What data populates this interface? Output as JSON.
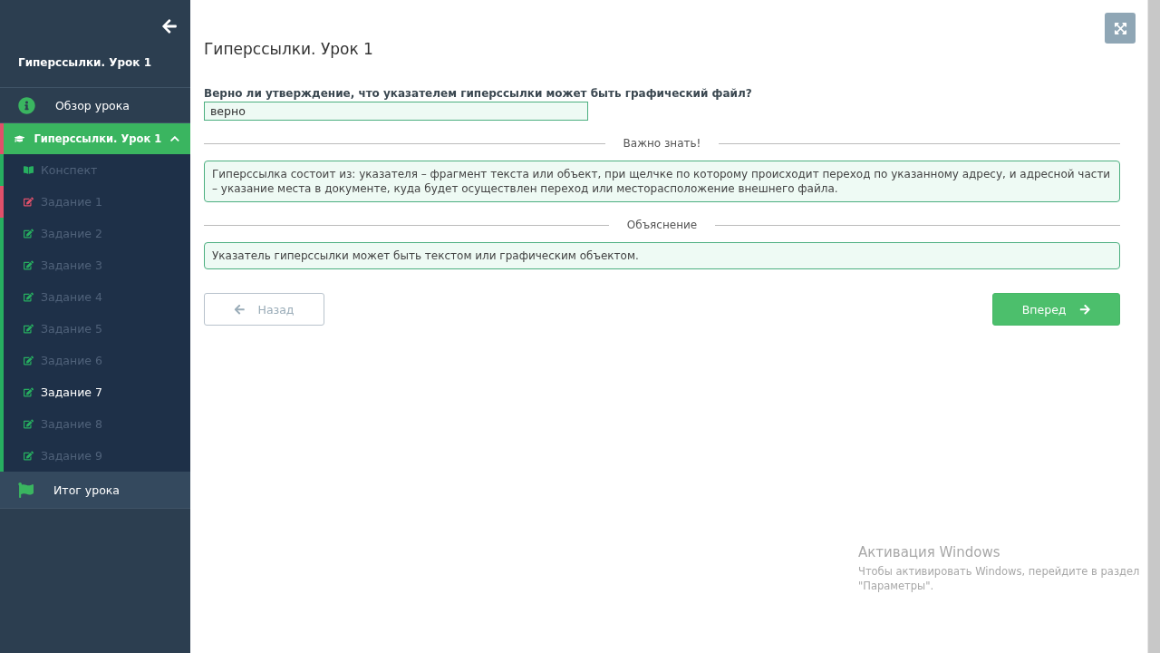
{
  "sidebar": {
    "title": "Гиперссылки. Урок 1",
    "overview": {
      "label": "Обзор урока"
    },
    "lesson": {
      "label": "Гиперссылки. Урок 1",
      "expanded": true,
      "children": [
        {
          "label": "Конспект",
          "kind": "notes",
          "color": "#27ae60",
          "selected": false
        },
        {
          "label": "Задание 1",
          "kind": "task",
          "color": "#e0506a",
          "selected": false
        },
        {
          "label": "Задание 2",
          "kind": "task",
          "color": "#27ae60",
          "selected": false
        },
        {
          "label": "Задание 3",
          "kind": "task",
          "color": "#27ae60",
          "selected": false
        },
        {
          "label": "Задание 4",
          "kind": "task",
          "color": "#27ae60",
          "selected": false
        },
        {
          "label": "Задание 5",
          "kind": "task",
          "color": "#27ae60",
          "selected": false
        },
        {
          "label": "Задание 6",
          "kind": "task",
          "color": "#27ae60",
          "selected": false
        },
        {
          "label": "Задание 7",
          "kind": "task",
          "color": "#27ae60",
          "selected": true
        },
        {
          "label": "Задание 8",
          "kind": "task",
          "color": "#27ae60",
          "selected": false
        },
        {
          "label": "Задание 9",
          "kind": "task",
          "color": "#27ae60",
          "selected": false
        }
      ]
    },
    "summary": {
      "label": "Итог урока"
    }
  },
  "main": {
    "title": "Гиперссылки. Урок 1",
    "question": "Верно ли утверждение, что указателем гиперссылки может быть графический файл?",
    "answer": {
      "value": "верно"
    },
    "sections": [
      {
        "heading": "Важно знать!",
        "text": "Гиперссылка состоит из: указателя – фрагмент текста или объект, при щелчке по которому происходит переход по указанному адресу, и адресной части – указание места в документе, куда будет осуществлен переход или месторасположение внешнего файла."
      },
      {
        "heading": "Объяснение",
        "text": "Указатель гиперссылки может быть текстом или графическим объектом."
      }
    ],
    "back_button": {
      "label": "Назад",
      "disabled": true
    },
    "next_button": {
      "label": "Вперед"
    }
  },
  "os_notice": {
    "title": "Активация Windows",
    "lines": [
      "Чтобы активировать Windows, перейдите в раздел",
      "\"Параметры\"."
    ]
  }
}
